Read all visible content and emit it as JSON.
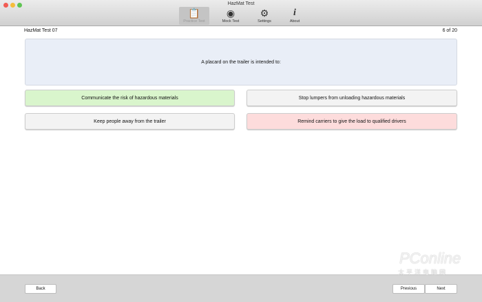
{
  "window": {
    "title": "HazMat Test"
  },
  "toolbar": [
    {
      "label": "Practice Test",
      "icon": "clipboard-icon",
      "selected": true
    },
    {
      "label": "Mock Test",
      "icon": "stopwatch-icon"
    },
    {
      "label": "Settings",
      "icon": "gear-icon"
    },
    {
      "label": "About",
      "icon": "info-icon"
    }
  ],
  "header": {
    "test_name": "HazMat Test 07",
    "progress": "6 of 20"
  },
  "question": "A placard on the trailer is intended to:",
  "answers": [
    {
      "text": "Communicate the risk of hazardous materials",
      "state": "correct"
    },
    {
      "text": "Stop lumpers from unloading hazardous materials",
      "state": "neutral"
    },
    {
      "text": "Keep people away from the trailer",
      "state": "neutral"
    },
    {
      "text": "Remind carriers to give the load to qualified drivers",
      "state": "wrong"
    }
  ],
  "footer": {
    "back": "Back",
    "previous": "Previous",
    "next": "Next"
  },
  "watermark": {
    "brand": "PConline",
    "sub": "太平洋电脑网"
  },
  "colors": {
    "correct": "#d9f5cc",
    "wrong": "#fddcdc",
    "question_bg": "#e9eef7"
  }
}
